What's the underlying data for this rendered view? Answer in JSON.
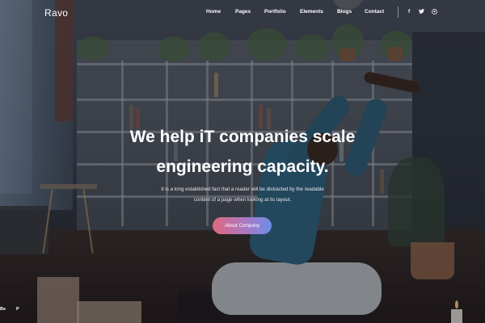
{
  "brand": {
    "logo": "Ravo"
  },
  "nav": {
    "items": [
      "Home",
      "Pages",
      "Portfolio",
      "Elements",
      "Blogs",
      "Contact"
    ]
  },
  "social": {
    "facebook": "f",
    "twitter": "t",
    "pinterest": "p",
    "icons": [
      "facebook-icon",
      "twitter-icon",
      "pinterest-icon"
    ]
  },
  "hero": {
    "headline_line1": "We help iT companies scale",
    "headline_line2": "engineering capacity.",
    "subtext_line1": "It is a long established fact that a reader will be distracted by the readable",
    "subtext_line2": "content of a page when looking at its layout.",
    "cta_label": "About Company"
  },
  "bottom_social": {
    "behance": "Be",
    "pinterest": "P"
  },
  "colors": {
    "cta_gradient_start": "#e0687e",
    "cta_gradient_end": "#6b8ee8",
    "text": "#ffffff"
  }
}
